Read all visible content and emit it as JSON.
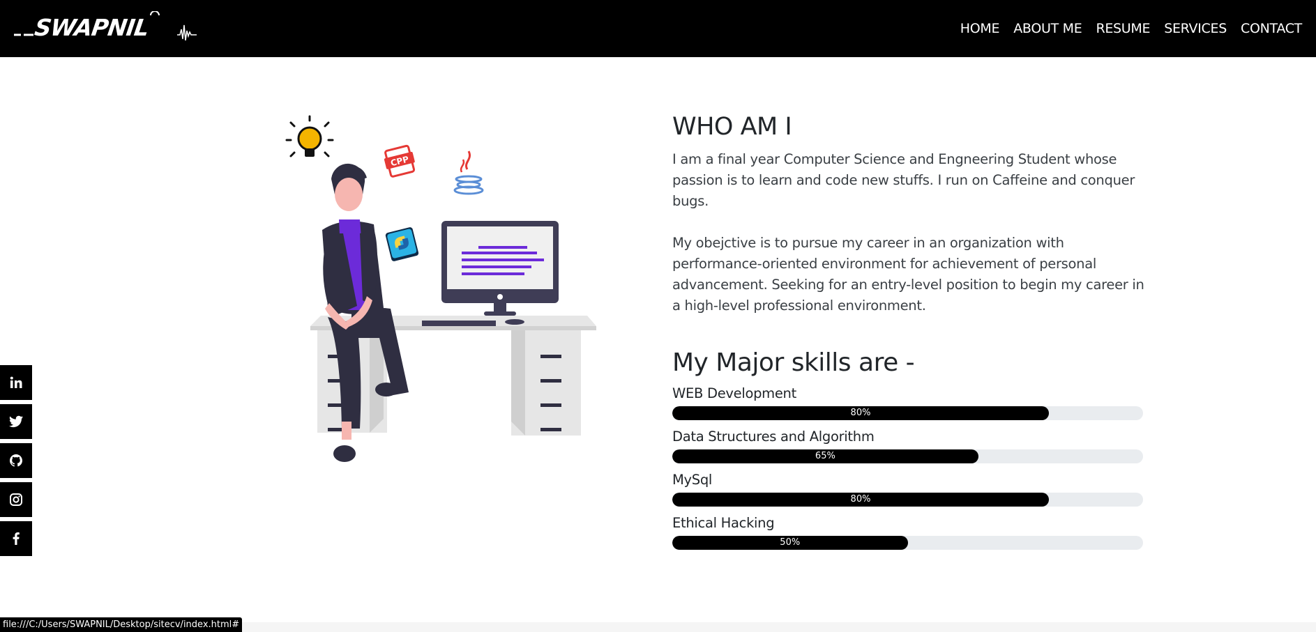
{
  "brand": {
    "name": "SWAPNIL"
  },
  "nav": {
    "items": [
      "HOME",
      "ABOUT ME",
      "RESUME",
      "SERVICES",
      "CONTACT"
    ]
  },
  "social": {
    "icons": [
      "linkedin-icon",
      "twitter-icon",
      "github-icon",
      "instagram-icon",
      "facebook-icon"
    ],
    "labels": [
      "in",
      "t",
      "gh",
      "ig",
      "f"
    ]
  },
  "about": {
    "heading": "WHO AM I",
    "paragraph1": "I am a final year Computer Science and Engneering Student whose passion is to learn and code new stuffs. I run on Caffeine and conquer bugs.",
    "paragraph2": "My obejctive is to pursue my career in an organization with performance-oriented environment for achievement of personal advancement. Seeking for an entry-level position to begin my career in a high-level professional environment."
  },
  "skills": {
    "heading": "My Major skills are -",
    "items": [
      {
        "name": "WEB Development",
        "percent": 80,
        "label": "80%"
      },
      {
        "name": "Data Structures and Algorithm",
        "percent": 65,
        "label": "65%"
      },
      {
        "name": "MySql",
        "percent": 80,
        "label": "80%"
      },
      {
        "name": "Ethical Hacking",
        "percent": 50,
        "label": "50%"
      }
    ]
  },
  "illustration": {
    "badge_cpp": "CPP"
  },
  "colors": {
    "navbar": "#000000",
    "progress_fill": "#000000",
    "progress_track": "#e9ecef",
    "accent_purple": "#6c2bd9"
  },
  "statusbar": {
    "url": "file:///C:/Users/SWAPNIL/Desktop/sitecv/index.html#"
  }
}
